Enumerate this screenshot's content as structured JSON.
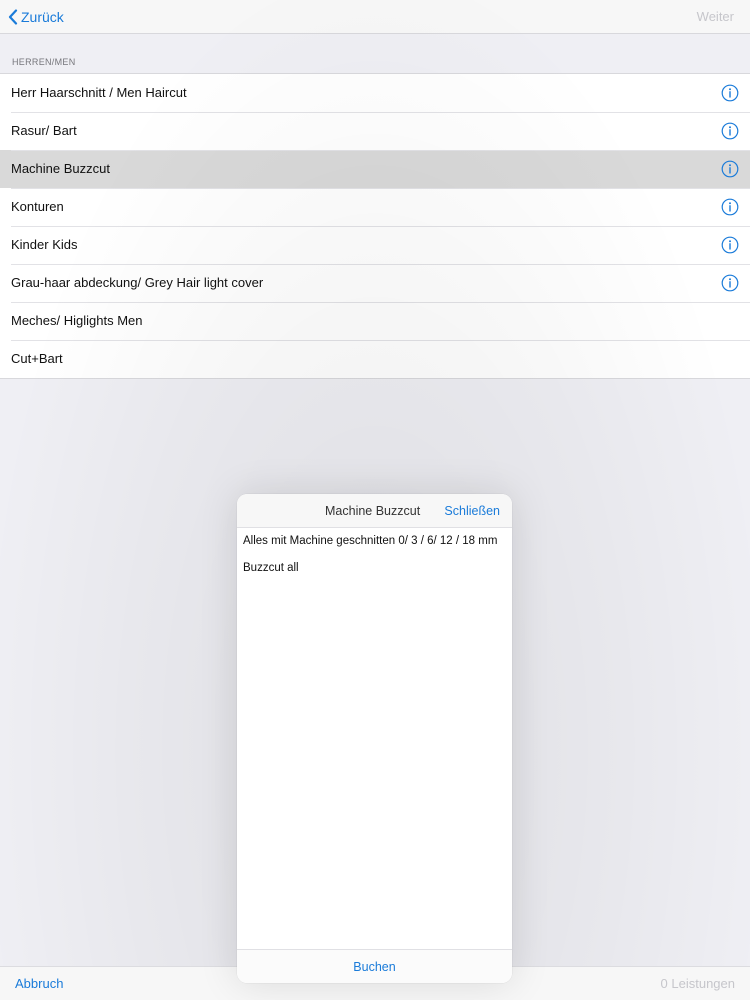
{
  "navbar": {
    "back_label": "Zurück",
    "next_label": "Weiter"
  },
  "section": {
    "header": "HERREN/MEN"
  },
  "services": [
    {
      "label": "Herr Haarschnitt / Men Haircut",
      "has_info": true,
      "selected": false
    },
    {
      "label": "Rasur/ Bart",
      "has_info": true,
      "selected": false
    },
    {
      "label": "Machine Buzzcut",
      "has_info": true,
      "selected": true
    },
    {
      "label": "Konturen",
      "has_info": true,
      "selected": false
    },
    {
      "label": "Kinder Kids",
      "has_info": true,
      "selected": false
    },
    {
      "label": "Grau-haar abdeckung/ Grey Hair light cover",
      "has_info": true,
      "selected": false
    },
    {
      "label": "Meches/ Higlights Men",
      "has_info": false,
      "selected": false
    },
    {
      "label": "Cut+Bart",
      "has_info": false,
      "selected": false
    }
  ],
  "popover": {
    "title": "Machine Buzzcut",
    "close_label": "Schließen",
    "description": "Alles mit Machine geschnitten 0/ 3 / 6/ 12 / 18 mm",
    "description_2": "Buzzcut all",
    "book_label": "Buchen"
  },
  "toolbar": {
    "cancel_label": "Abbruch",
    "count_label": "0 Leistungen"
  },
  "colors": {
    "accent": "#1a7bd9",
    "disabled": "#c6c6cb",
    "selected_row": "#d9d9d9",
    "background": "#efeff4"
  },
  "icons": {
    "back": "chevron-left-icon",
    "info": "info-circle-icon"
  }
}
